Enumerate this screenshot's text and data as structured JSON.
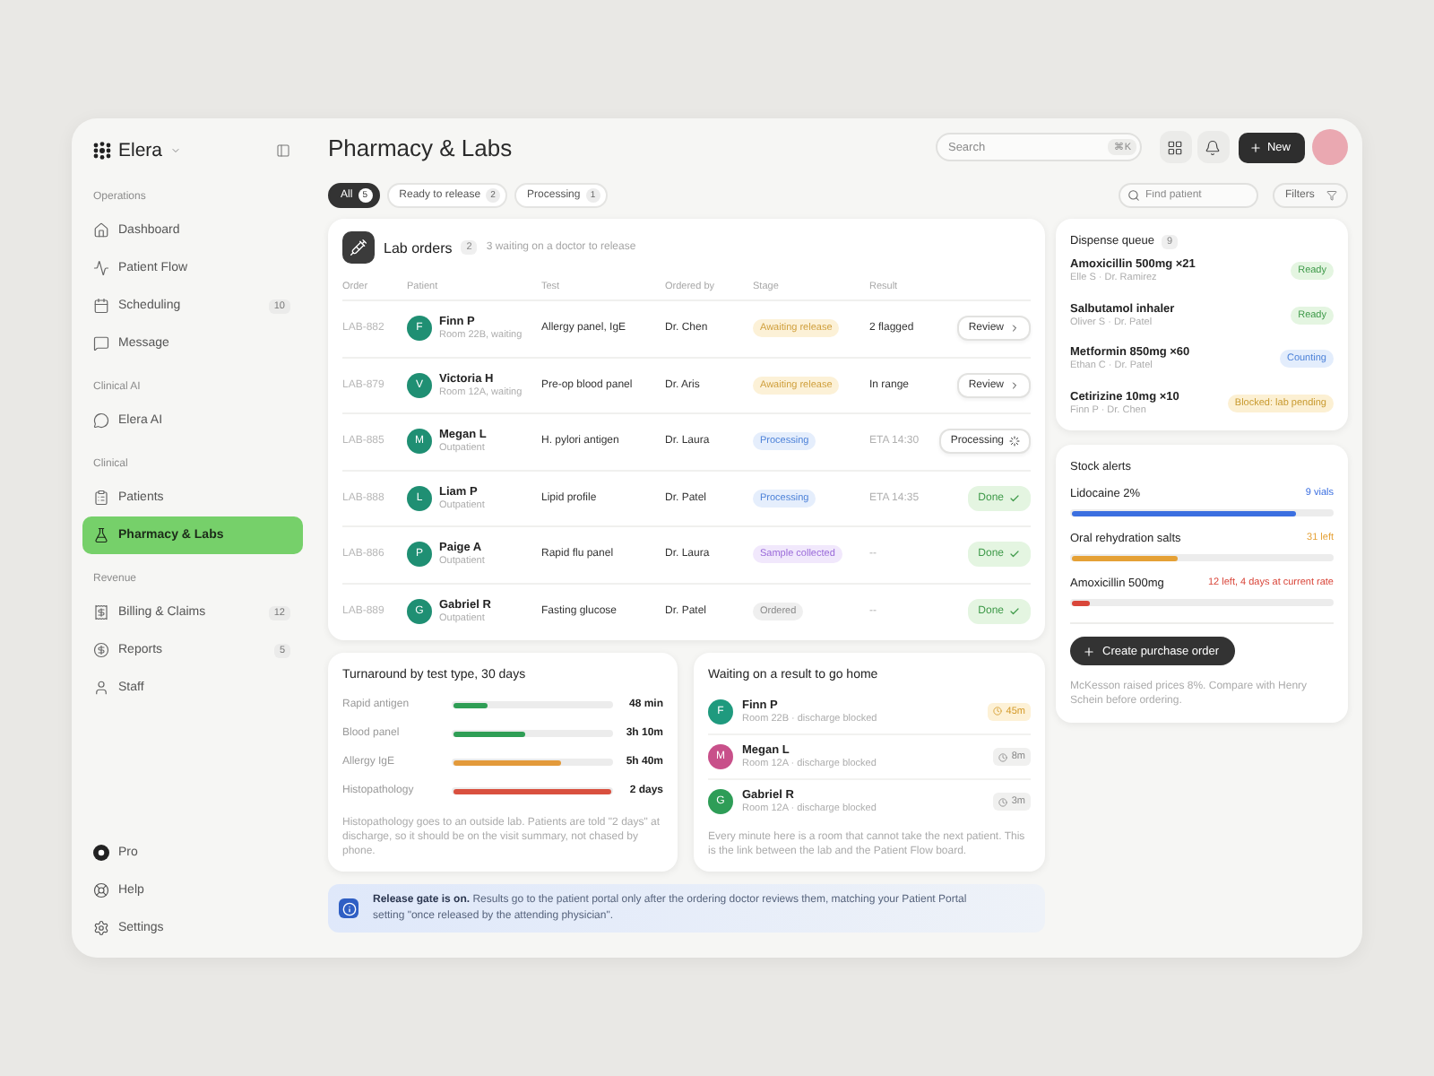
{
  "sidebar": {
    "brand": "Elera",
    "sections": [
      {
        "title": "Operations",
        "items": [
          {
            "label": "Dashboard",
            "selected": false
          },
          {
            "label": "Patient Flow",
            "selected": false
          },
          {
            "label": "Scheduling",
            "badge": "10",
            "selected": false
          },
          {
            "label": "Message",
            "selected": false
          }
        ]
      },
      {
        "title": "Clinical AI",
        "items": [
          {
            "label": "Elera AI",
            "selected": false
          }
        ]
      },
      {
        "title": "Clinical",
        "items": [
          {
            "label": "Patients",
            "selected": false
          },
          {
            "label": "Pharmacy & Labs",
            "selected": true
          }
        ]
      },
      {
        "title": "Revenue",
        "items": [
          {
            "label": "Billing & Claims",
            "badge": "12",
            "selected": false
          },
          {
            "label": "Reports",
            "badge": "5",
            "selected": false
          },
          {
            "label": "Staff",
            "selected": false
          }
        ]
      }
    ],
    "footer": [
      {
        "label": "Pro"
      },
      {
        "label": "Help"
      },
      {
        "label": "Settings"
      }
    ]
  },
  "header": {
    "title": "Pharmacy & Labs",
    "search": {
      "placeholder": "Search",
      "shortcut": "⌘K"
    },
    "new_button": "New"
  },
  "toolbar": {
    "tabs": [
      {
        "label": "All",
        "count": "5",
        "selected": true
      },
      {
        "label": "Ready to release",
        "count": "2",
        "selected": false
      },
      {
        "label": "Processing",
        "count": "1",
        "selected": false
      }
    ],
    "search": {
      "placeholder": "Find patient"
    },
    "filter_button": "Filters"
  },
  "lab_orders": {
    "title": "Lab orders",
    "count": "2",
    "subtitle": "3 waiting on a doctor to release",
    "columns": [
      "Order",
      "Patient",
      "Test",
      "Ordered by",
      "Stage",
      "Result"
    ],
    "rows": [
      {
        "order": "LAB-882",
        "initial": "F",
        "patient": "Finn P",
        "detail": "Room 22B, waiting",
        "test": "Allergy panel, IgE",
        "ordered_by": "Dr. Chen",
        "stage": {
          "label": "Awaiting release",
          "kind": "awaiting"
        },
        "result": {
          "text": "2 flagged",
          "muted": false
        },
        "action": {
          "label": "Review",
          "kind": "review"
        }
      },
      {
        "order": "LAB-879",
        "initial": "V",
        "patient": "Victoria H",
        "detail": "Room 12A, waiting",
        "test": "Pre-op blood panel",
        "ordered_by": "Dr. Aris",
        "stage": {
          "label": "Awaiting release",
          "kind": "awaiting"
        },
        "result": {
          "text": "In range",
          "muted": false
        },
        "action": {
          "label": "Review",
          "kind": "review"
        }
      },
      {
        "order": "LAB-885",
        "initial": "M",
        "patient": "Megan L",
        "detail": "Outpatient",
        "test": "H. pylori antigen",
        "ordered_by": "Dr. Laura",
        "stage": {
          "label": "Processing",
          "kind": "processing"
        },
        "result": {
          "text": "ETA 14:30",
          "muted": true
        },
        "action": {
          "label": "Processing",
          "kind": "processing"
        }
      },
      {
        "order": "LAB-888",
        "initial": "L",
        "patient": "Liam P",
        "detail": "Outpatient",
        "test": "Lipid profile",
        "ordered_by": "Dr. Patel",
        "stage": {
          "label": "Processing",
          "kind": "processing"
        },
        "result": {
          "text": "ETA 14:35",
          "muted": true
        },
        "action": {
          "label": "Done",
          "kind": "done"
        }
      },
      {
        "order": "LAB-886",
        "initial": "P",
        "patient": "Paige A",
        "detail": "Outpatient",
        "test": "Rapid flu panel",
        "ordered_by": "Dr. Laura",
        "stage": {
          "label": "Sample collected",
          "kind": "collected"
        },
        "result": {
          "text": "--",
          "muted": true
        },
        "action": {
          "label": "Done",
          "kind": "done"
        }
      },
      {
        "order": "LAB-889",
        "initial": "G",
        "patient": "Gabriel R",
        "detail": "Outpatient",
        "test": "Fasting glucose",
        "ordered_by": "Dr. Patel",
        "stage": {
          "label": "Ordered",
          "kind": "ordered"
        },
        "result": {
          "text": "--",
          "muted": true
        },
        "action": {
          "label": "Done",
          "kind": "done"
        }
      }
    ]
  },
  "turnaround": {
    "title": "Turnaround by test type, 30 days",
    "rows": [
      {
        "label": "Rapid antigen",
        "level": 0.22,
        "color": "#2f9e55",
        "value": "48 min"
      },
      {
        "label": "Blood panel",
        "level": 0.45,
        "color": "#2f9e55",
        "value": "3h 10m"
      },
      {
        "label": "Allergy IgE",
        "level": 0.68,
        "color": "#e39a3b",
        "value": "5h 40m"
      },
      {
        "label": "Histopathology",
        "level": 1,
        "color": "#d9503f",
        "value": "2 days"
      }
    ],
    "note": "Histopathology goes to an outside lab. Patients are told \"2 days\" at discharge, so it should be on the visit summary, not chased by phone."
  },
  "waiting": {
    "title": "Waiting on a result to go home",
    "items": [
      {
        "initial": "F",
        "name": "Finn P",
        "detail": "Room 22B · discharge blocked",
        "time": "45m",
        "urgent": true,
        "color": "#1f9a7e"
      },
      {
        "initial": "M",
        "name": "Megan L",
        "detail": "Room 12A · discharge blocked",
        "time": "8m",
        "urgent": false,
        "color": "#c8508a"
      },
      {
        "initial": "G",
        "name": "Gabriel R",
        "detail": "Room 12A · discharge blocked",
        "time": "3m",
        "urgent": false,
        "color": "#2e9d57"
      }
    ],
    "note": "Every minute here is a room that cannot take the next patient. This is the link between the lab and the Patient Flow board."
  },
  "banner": {
    "text": "**Release gate is on.** Results go to the patient portal only after the ordering doctor reviews them, matching your Patient Portal setting \"once released by the attending physician\"."
  },
  "dispense": {
    "title": "Dispense queue",
    "count": "9",
    "items": [
      {
        "name": "Amoxicillin 500mg ×21",
        "detail": "Elle S · Dr. Ramirez",
        "status": {
          "label": "Ready",
          "kind": "ready"
        }
      },
      {
        "name": "Salbutamol inhaler",
        "detail": "Oliver S · Dr. Patel",
        "status": {
          "label": "Ready",
          "kind": "ready"
        }
      },
      {
        "name": "Metformin 850mg ×60",
        "detail": "Ethan C · Dr. Patel",
        "status": {
          "label": "Counting",
          "kind": "counting"
        }
      },
      {
        "name": "Cetirizine 10mg ×10",
        "detail": "Finn P · Dr. Chen",
        "status": {
          "label": "Blocked: lab pending",
          "kind": "blocked"
        }
      }
    ]
  },
  "stock": {
    "title": "Stock alerts",
    "items": [
      {
        "name": "Lidocaine 2%",
        "reading": "9 vials",
        "level": 0.86,
        "color": "#3b6fe0"
      },
      {
        "name": "Oral rehydration salts",
        "reading": "31 left",
        "level": 0.41,
        "color": "#e5a136"
      },
      {
        "name": "Amoxicillin 500mg",
        "reading": "12 left, 4 days at current rate",
        "level": 0.07,
        "color": "#d9463a"
      }
    ],
    "button": "Create purchase order",
    "note": "McKesson raised prices 8%. Compare with Henry Schein before ordering."
  }
}
